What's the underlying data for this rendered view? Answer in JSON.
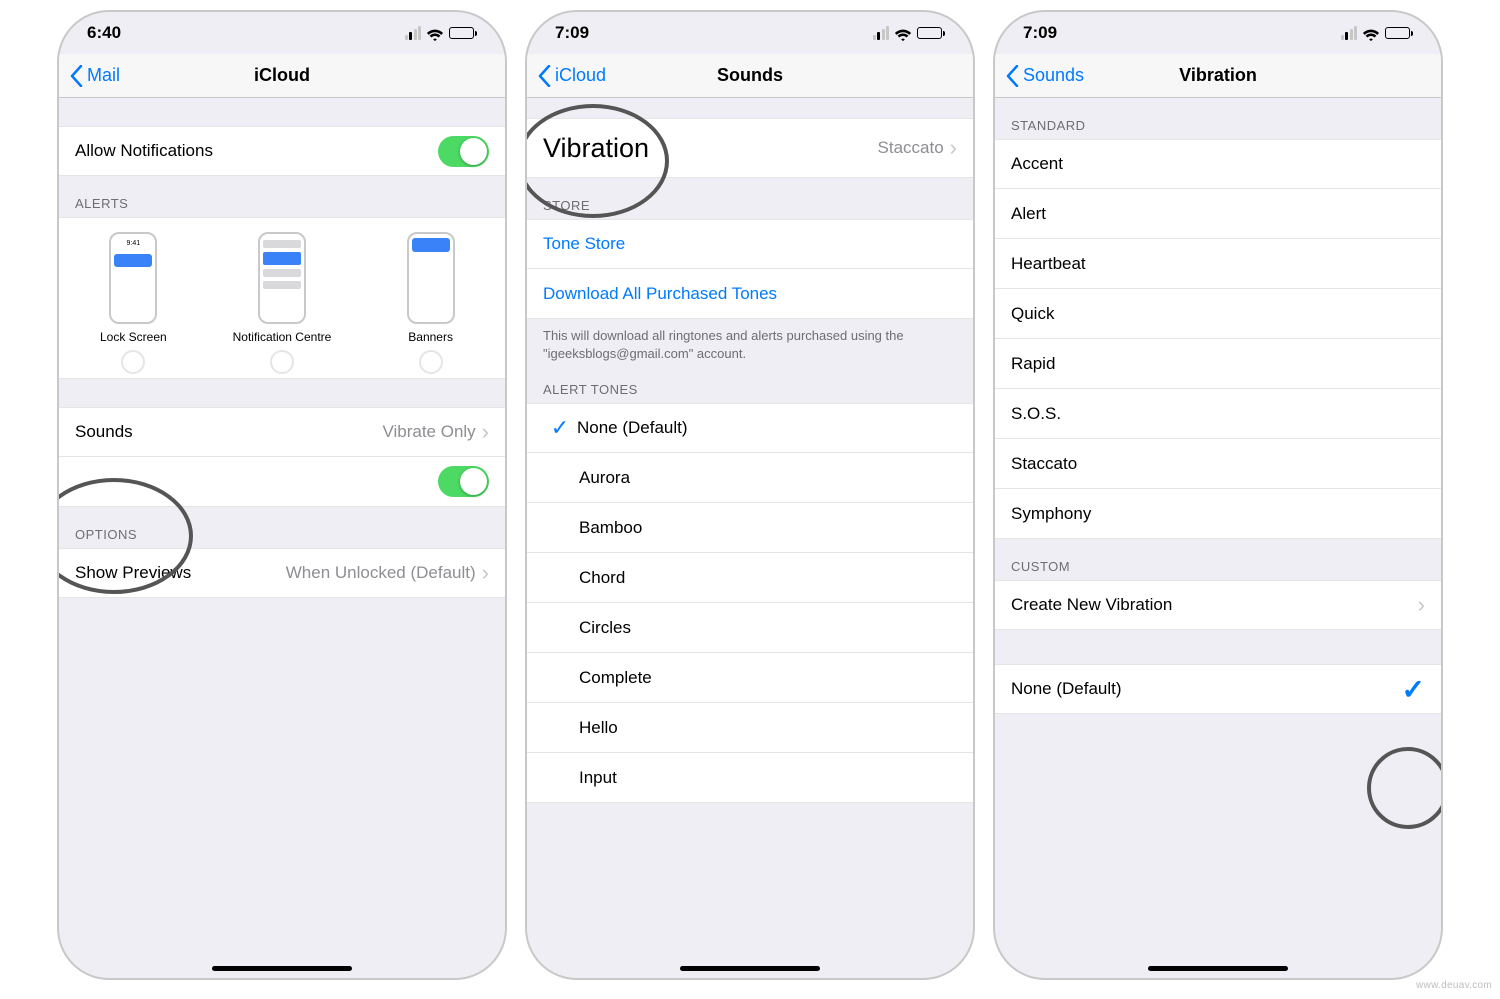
{
  "watermark": "www.deuav.com",
  "screen1": {
    "time": "6:40",
    "back": "Mail",
    "title": "iCloud",
    "allow_notifications": "Allow Notifications",
    "alerts_header": "ALERTS",
    "alerts": {
      "lock": "Lock Screen",
      "center": "Notification Centre",
      "banners": "Banners"
    },
    "sounds_label": "Sounds",
    "sounds_value": "Vibrate Only",
    "options_header": "OPTIONS",
    "show_previews": "Show Previews",
    "show_previews_value": "When Unlocked (Default)"
  },
  "screen2": {
    "time": "7:09",
    "back": "iCloud",
    "title": "Sounds",
    "vibration_label": "Vibration",
    "vibration_value": "Staccato",
    "store_header": "STORE",
    "tone_store": "Tone Store",
    "download": "Download All Purchased Tones",
    "note": "This will download all ringtones and alerts purchased using the \"igeeksblogs@gmail.com\" account.",
    "alert_tones_header": "ALERT TONES",
    "none_default": "None (Default)",
    "tones": [
      "Aurora",
      "Bamboo",
      "Chord",
      "Circles",
      "Complete",
      "Hello",
      "Input"
    ]
  },
  "screen3": {
    "time": "7:09",
    "back": "Sounds",
    "title": "Vibration",
    "standard_header": "STANDARD",
    "standard": [
      "Accent",
      "Alert",
      "Heartbeat",
      "Quick",
      "Rapid",
      "S.O.S.",
      "Staccato",
      "Symphony"
    ],
    "custom_header": "CUSTOM",
    "create_new": "Create New Vibration",
    "none_default": "None (Default)"
  }
}
